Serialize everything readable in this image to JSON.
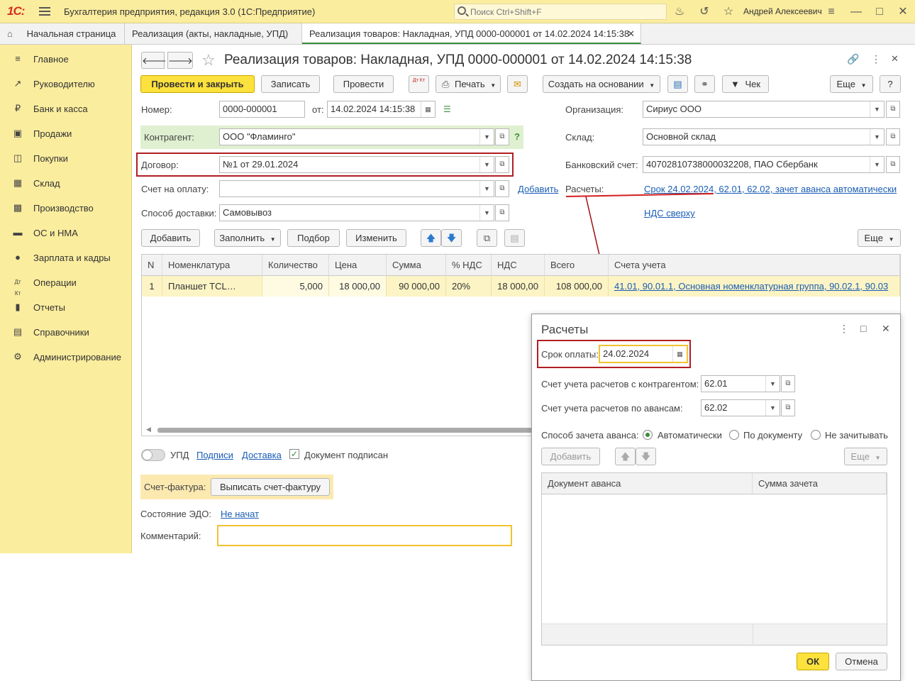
{
  "app": {
    "logo": "1С:",
    "title": "Бухгалтерия предприятия, редакция 3.0  (1С:Предприятие)",
    "search_placeholder": "Поиск Ctrl+Shift+F",
    "user": "Андрей Алексеевич"
  },
  "tabs": [
    {
      "label": "Начальная страница"
    },
    {
      "label": "Реализация (акты, накладные, УПД)"
    },
    {
      "label": "Реализация товаров: Накладная, УПД 0000-000001 от 14.02.2024 14:15:38"
    }
  ],
  "sidebar": {
    "items": [
      {
        "label": "Главное",
        "icon": "menu-icon"
      },
      {
        "label": "Руководителю",
        "icon": "trend-icon"
      },
      {
        "label": "Банк и касса",
        "icon": "ruble-icon"
      },
      {
        "label": "Продажи",
        "icon": "bag-icon"
      },
      {
        "label": "Покупки",
        "icon": "cart-icon"
      },
      {
        "label": "Склад",
        "icon": "warehouse-icon"
      },
      {
        "label": "Производство",
        "icon": "factory-icon"
      },
      {
        "label": "ОС и НМА",
        "icon": "truck-icon"
      },
      {
        "label": "Зарплата и кадры",
        "icon": "person-icon"
      },
      {
        "label": "Операции",
        "icon": "dt-kt-icon"
      },
      {
        "label": "Отчеты",
        "icon": "chart-icon"
      },
      {
        "label": "Справочники",
        "icon": "book-icon"
      },
      {
        "label": "Администрирование",
        "icon": "gear-icon"
      }
    ]
  },
  "doc": {
    "title": "Реализация товаров: Накладная, УПД 0000-000001 от 14.02.2024 14:15:38",
    "toolbar": {
      "post_close": "Провести и закрыть",
      "save": "Записать",
      "post": "Провести",
      "dtkt": "Дт Кт",
      "print": "Печать",
      "create_based": "Создать на основании",
      "check": "Чек",
      "more": "Еще",
      "help": "?"
    },
    "fields": {
      "number_label": "Номер:",
      "number": "0000-000001",
      "date_label": "от:",
      "date": "14.02.2024 14:15:38",
      "counterparty_label": "Контрагент:",
      "counterparty": "ООО \"Фламинго\"",
      "contract_label": "Договор:",
      "contract": "№1 от 29.01.2024",
      "invoice_label": "Счет на оплату:",
      "invoice": "",
      "add_link": "Добавить",
      "delivery_label": "Способ доставки:",
      "delivery": "Самовывоз",
      "org_label": "Организация:",
      "org": "Сириус ООО",
      "warehouse_label": "Склад:",
      "warehouse": "Основной склад",
      "bank_label": "Банковский счет:",
      "bank": "40702810738000032208, ПАО Сбербанк",
      "settlements_label": "Расчеты:",
      "settlements_link": "Срок 24.02.2024, 62.01, 62.02, зачет аванса автоматически",
      "vat_link": "НДС сверху"
    },
    "table_toolbar": {
      "add": "Добавить",
      "fill": "Заполнить",
      "pick": "Подбор",
      "change": "Изменить",
      "more": "Еще"
    },
    "table": {
      "columns": [
        "N",
        "Номенклатура",
        "Количество",
        "Цена",
        "Сумма",
        "% НДС",
        "НДС",
        "Всего",
        "Счета учета"
      ],
      "rows": [
        [
          "1",
          "Планшет TCL…",
          "5,000",
          "18 000,00",
          "90 000,00",
          "20%",
          "18 000,00",
          "108 000,00",
          "41.01, 90.01.1, Основная номенклатурная группа, 90.02.1, 90.03"
        ]
      ]
    },
    "footer": {
      "upd_label": "УПД",
      "signatures_link": "Подписи",
      "delivery_link": "Доставка",
      "signed_label": "Документ подписан",
      "invoice_label": "Счет-фактура:",
      "invoice_button": "Выписать счет-фактуру",
      "edo_label": "Состояние ЭДО:",
      "edo_link": "Не начат",
      "comment_label": "Комментарий:",
      "comment": ""
    }
  },
  "dialog": {
    "title": "Расчеты",
    "due_label": "Срок оплаты:",
    "due_date": "24.02.2024",
    "acc_cp_label": "Счет учета расчетов с контрагентом:",
    "acc_cp": "62.01",
    "acc_adv_label": "Счет учета расчетов по авансам:",
    "acc_adv": "62.02",
    "offset_label": "Способ зачета аванса:",
    "offset_options": [
      "Автоматически",
      "По документу",
      "Не зачитывать"
    ],
    "offset_selected": "Автоматически",
    "add": "Добавить",
    "more": "Еще",
    "columns": [
      "Документ аванса",
      "Сумма зачета"
    ],
    "ok": "ОК",
    "cancel": "Отмена"
  }
}
